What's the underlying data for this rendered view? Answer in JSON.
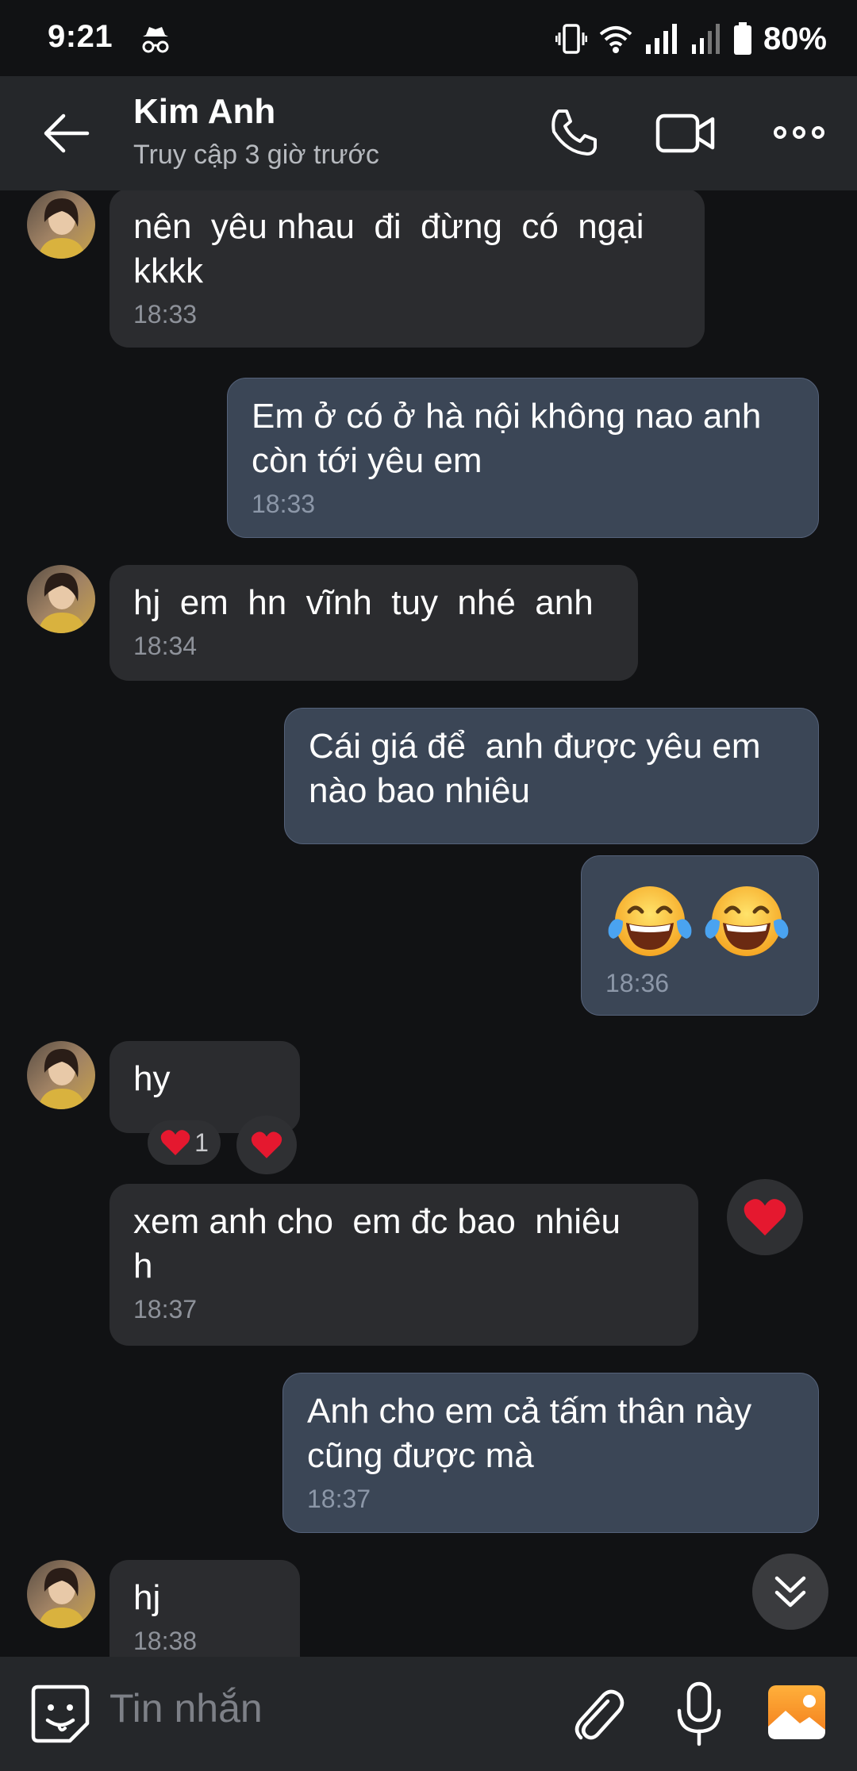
{
  "status_bar": {
    "time": "9:21",
    "battery": "80%",
    "icons": [
      "incognito-icon",
      "vibrate-icon",
      "wifi-icon",
      "signal-icon",
      "signal-icon",
      "battery-icon"
    ]
  },
  "header": {
    "contact_name": "Kim Anh",
    "contact_status": "Truy cập 3 giờ trước",
    "icons": [
      "back-arrow-icon",
      "phone-icon",
      "video-camera-icon",
      "more-icon"
    ]
  },
  "messages": [
    {
      "dir": "in",
      "text": "nên  yêu nhau  đi  đừng  có  ngại\nkkkk",
      "time": "18:33"
    },
    {
      "dir": "out",
      "text": "Em ở có ở hà nội không nao anh\ncòn tới yêu em",
      "time": "18:33"
    },
    {
      "dir": "in",
      "text": "hj  em  hn  vĩnh  tuy  nhé  anh",
      "time": "18:34"
    },
    {
      "dir": "out",
      "text": "Cái giá để  anh được yêu em\nnào bao nhiêu",
      "time": ""
    },
    {
      "dir": "out",
      "text": "😂😂",
      "time": "18:36"
    },
    {
      "dir": "in",
      "text": "hy",
      "time": "",
      "reaction_count": "1"
    },
    {
      "dir": "in",
      "text": "xem anh cho  em đc bao  nhiêu\nh",
      "time": "18:37"
    },
    {
      "dir": "out",
      "text": "Anh cho em cả tấm thân này\ncũng được mà",
      "time": "18:37"
    },
    {
      "dir": "in",
      "text": "hj",
      "time": "18:38"
    }
  ],
  "composer": {
    "placeholder": "Tin nhắn",
    "icons": [
      "sticker-icon",
      "paperclip-icon",
      "microphone-icon",
      "photo-icon"
    ]
  },
  "colors": {
    "background": "#111214",
    "header": "#25272a",
    "incoming_bubble": "#2b2c2f",
    "outgoing_bubble": "#3b4656",
    "heart": "#e5182f"
  }
}
